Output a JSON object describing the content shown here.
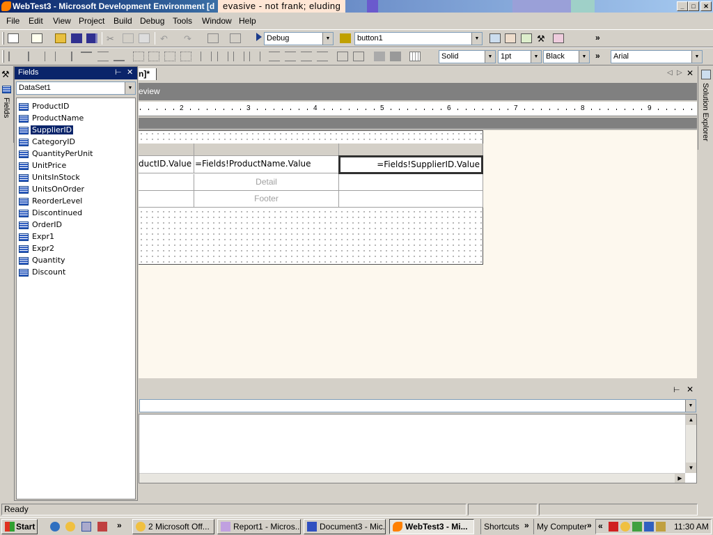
{
  "titlebar": {
    "title": "WebTest3 - Microsoft Development Environment [d",
    "tooltip": "evasive - not frank; eluding",
    "minimize": "_",
    "maximize": "□",
    "close": "✕"
  },
  "menu": [
    "File",
    "Edit",
    "View",
    "Project",
    "Build",
    "Debug",
    "Tools",
    "Window",
    "Help"
  ],
  "toolbar1": {
    "config": "Debug",
    "target": "button1",
    "overflow": "»"
  },
  "toolbar2": {
    "line_style": "Solid",
    "line_width": "1pt",
    "line_color": "Black",
    "overflow": "»",
    "font": "Arial"
  },
  "left_strip": {
    "fields_tab": "Fields"
  },
  "fields_panel": {
    "title": "Fields",
    "pin": "⊢",
    "close": "✕",
    "dataset": "DataSet1",
    "fields": [
      "ProductID",
      "ProductName",
      "SupplierID",
      "CategoryID",
      "QuantityPerUnit",
      "UnitPrice",
      "UnitsInStock",
      "UnitsOnOrder",
      "ReorderLevel",
      "Discontinued",
      "OrderID",
      "Expr1",
      "Expr2",
      "Quantity",
      "Discount"
    ],
    "selected": "SupplierID"
  },
  "document": {
    "tab_label": "n]*",
    "preview_label": "eview",
    "ruler_numbers": [
      "2",
      "3",
      "4",
      "5",
      "6",
      "7",
      "8",
      "9"
    ],
    "table": {
      "detail_row": [
        "ductID.Value",
        "=Fields!ProductName.Value",
        "=Fields!SupplierID.Value"
      ],
      "detail_placeholder": "Detail",
      "footer_placeholder": "Footer"
    }
  },
  "right_strip": {
    "solution_explorer": "Solution Explorer"
  },
  "output_panel": {
    "pin": "⊢",
    "close": "✕"
  },
  "statusbar": {
    "text": "Ready"
  },
  "taskbar": {
    "start": "Start",
    "tasks": [
      "2 Microsoft Off...",
      "Report1 - Micros...",
      "Document3 - Mic...",
      "WebTest3 - Mi..."
    ],
    "active_task": "WebTest3 - Mi...",
    "shortcuts": "Shortcuts",
    "my_computer": "My Computer",
    "overflow": "»",
    "tray_chevron": "«",
    "time": "11:30 AM"
  }
}
